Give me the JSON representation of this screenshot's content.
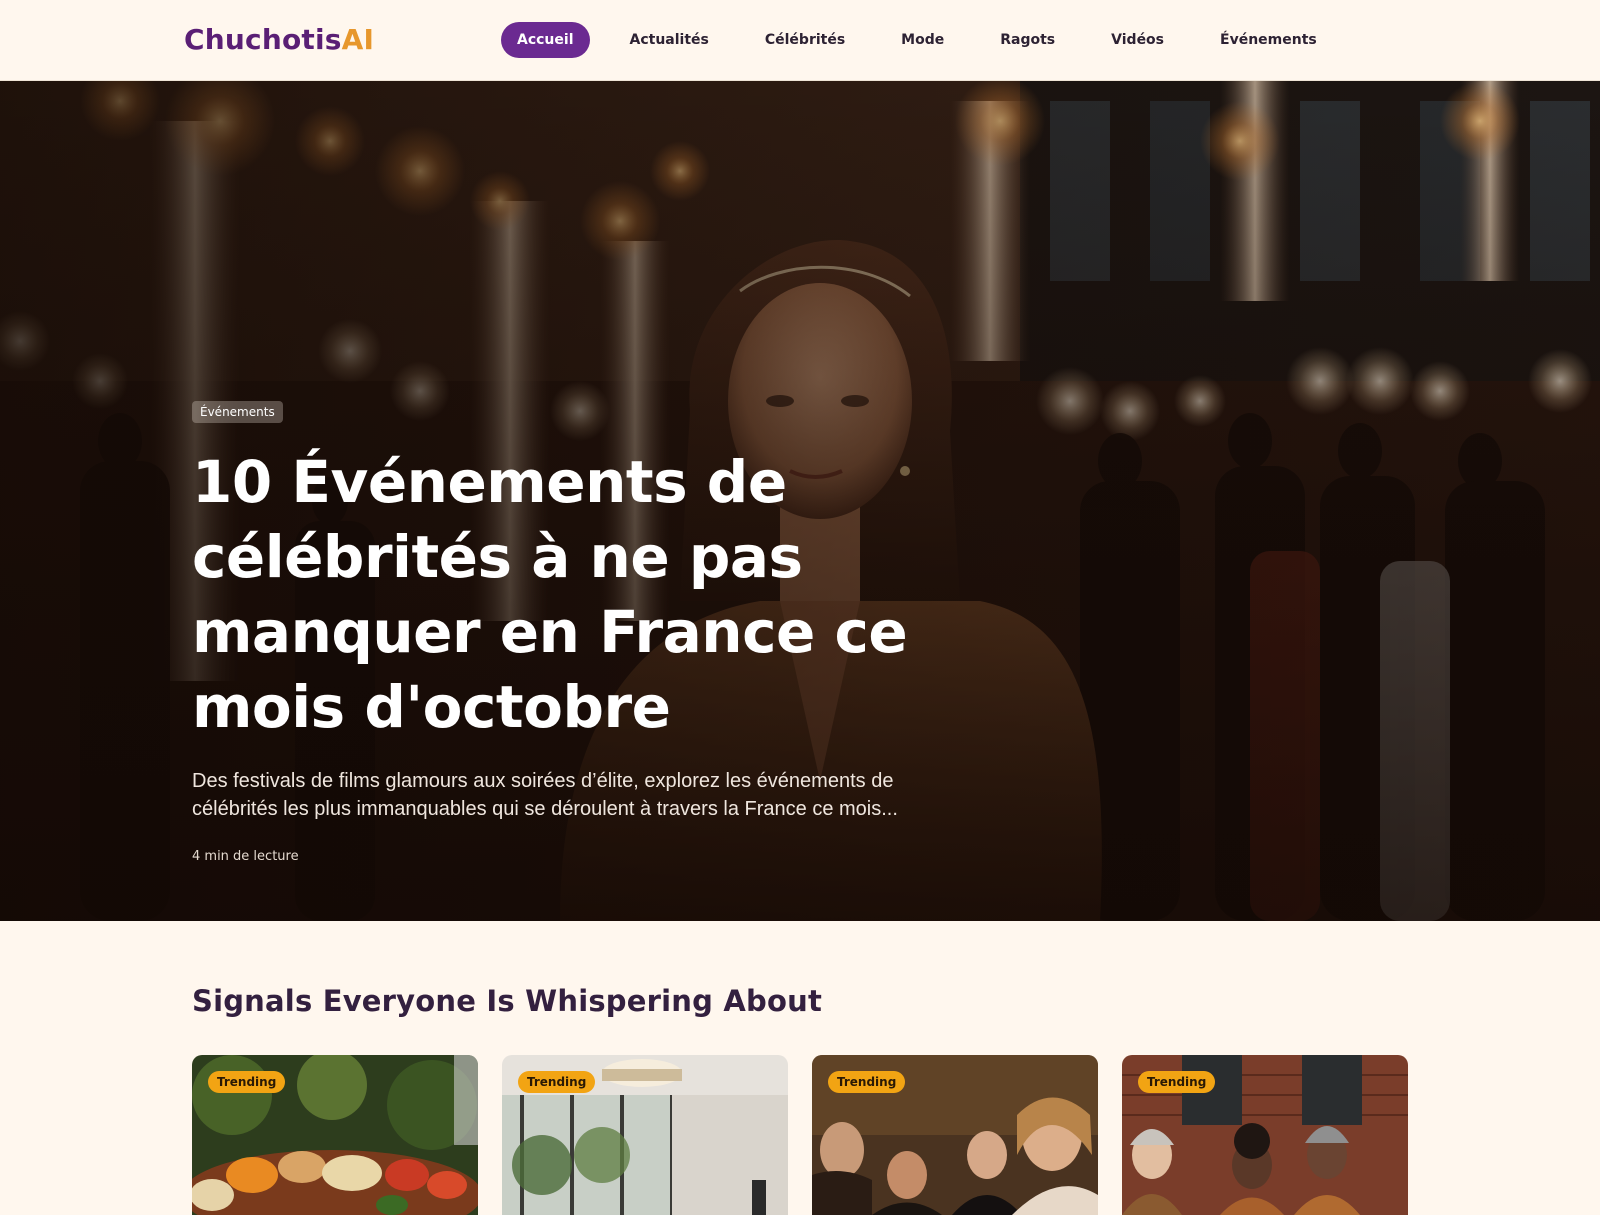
{
  "brand": {
    "name": "Chuchotis",
    "accent": "AI"
  },
  "nav": {
    "items": [
      {
        "label": "Accueil",
        "active": true
      },
      {
        "label": "Actualités",
        "active": false
      },
      {
        "label": "Célébrités",
        "active": false
      },
      {
        "label": "Mode",
        "active": false
      },
      {
        "label": "Ragots",
        "active": false
      },
      {
        "label": "Vidéos",
        "active": false
      },
      {
        "label": "Événements",
        "active": false
      }
    ]
  },
  "hero": {
    "category": "Événements",
    "title": "10 Événements de célébrités à ne pas manquer en France ce mois d'octobre",
    "description": "Des festivals de films glamours aux soirées d’élite, explorez les événements de célébrités les plus immanquables qui se déroulent à travers la France ce mois...",
    "read_time": "4 min de lecture"
  },
  "section": {
    "title": "Signals Everyone Is Whispering About",
    "cards": [
      {
        "tag": "Trending"
      },
      {
        "tag": "Trending"
      },
      {
        "tag": "Trending"
      },
      {
        "tag": "Trending"
      }
    ]
  },
  "colors": {
    "page_bg": "#fff7ee",
    "brand_purple": "#5a1f75",
    "brand_accent": "#e7972c",
    "nav_active_bg": "#6b2a91",
    "tag_bg": "#f2a413",
    "heading": "#33203f"
  }
}
